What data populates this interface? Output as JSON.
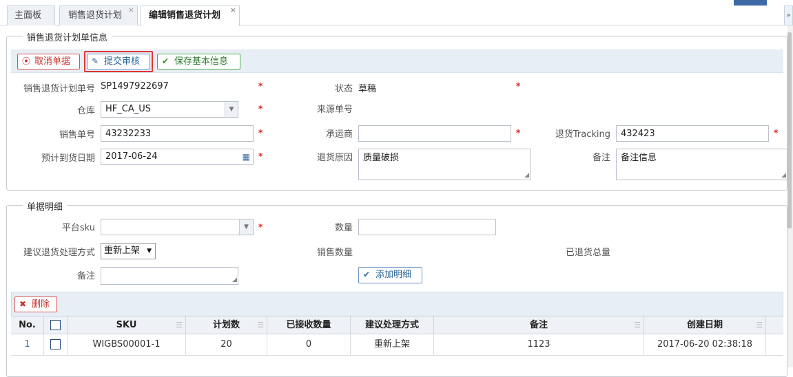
{
  "tabs": [
    {
      "label": "主面板"
    },
    {
      "label": "销售退货计划"
    },
    {
      "label": "编辑销售退货计划"
    }
  ],
  "tab_close_glyph": "×",
  "basic_info": {
    "legend": "销售退货计划单信息",
    "buttons": {
      "cancel": "取消单据",
      "submit": "提交审核",
      "save": "保存基本信息"
    },
    "fields": {
      "plan_no_label": "销售退货计划单号",
      "plan_no_value": "SP1497922697",
      "status_label": "状态",
      "status_value": "草稿",
      "warehouse_label": "仓库",
      "warehouse_value": "HF_CA_US",
      "source_no_label": "来源单号",
      "sales_no_label": "销售单号",
      "sales_no_value": "43232233",
      "carrier_label": "承运商",
      "carrier_value": "",
      "tracking_label": "退货Tracking",
      "tracking_value": "432423",
      "eta_label": "预计到货日期",
      "eta_value": "2017-06-24",
      "reason_label": "退货原因",
      "reason_value": "质量破损",
      "remark_label": "备注",
      "remark_value": "备注信息"
    }
  },
  "detail": {
    "legend": "单据明细",
    "platform_sku_label": "平台sku",
    "platform_sku_value": "",
    "qty_label": "数量",
    "qty_value": "",
    "method_label": "建议退货处理方式",
    "method_value": "重新上架",
    "sales_qty_label": "销售数量",
    "returned_total_label": "已退货总量",
    "remark_label": "备注",
    "remark_value": "",
    "add_button": "添加明细",
    "delete_button": "删除"
  },
  "grid": {
    "columns": [
      "No.",
      "",
      "SKU",
      "计划数",
      "已接收数量",
      "建议处理方式",
      "备注",
      "创建日期"
    ],
    "rows": [
      {
        "no": "1",
        "sku": "WIGBS00001-1",
        "planned": "20",
        "received": "0",
        "method": "重新上架",
        "remark": "1123",
        "created": "2017-06-20 02:38:18"
      }
    ]
  },
  "required_mark": "*",
  "icons": {
    "cancel": "circle-dot-icon",
    "submit": "edit-icon",
    "save": "check-icon",
    "add": "check-icon",
    "delete": "x-icon",
    "calendar": "calendar-icon",
    "dropdown": "chevron-down-icon"
  },
  "colors": {
    "required": "#d62222",
    "highlight": "#e03434",
    "toolbar_bg": "#e8eef5"
  }
}
